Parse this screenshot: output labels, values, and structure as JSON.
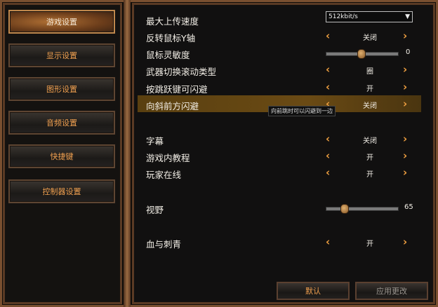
{
  "sidebar": {
    "items": [
      {
        "label": "游戏设置",
        "active": true
      },
      {
        "label": "显示设置",
        "active": false
      },
      {
        "label": "图形设置",
        "active": false
      },
      {
        "label": "音频设置",
        "active": false
      },
      {
        "label": "快捷键",
        "active": false
      },
      {
        "label": "控制器设置",
        "active": false
      }
    ]
  },
  "settings": {
    "upload_speed": {
      "label": "最大上传速度",
      "value": "512kbit/s"
    },
    "invert_mouse_y": {
      "label": "反转鼠标Y轴",
      "value": "关闭"
    },
    "mouse_sensitivity": {
      "label": "鼠标灵敏度",
      "value": "0"
    },
    "weapon_switch": {
      "label": "武器切换滚动类型",
      "value": "圈"
    },
    "jump_dodge": {
      "label": "按跳跃键可闪避",
      "value": "开"
    },
    "diagonal_dodge": {
      "label": "向斜前方闪避",
      "value": "关闭",
      "tooltip": "向前跳时可以闪避到一边"
    },
    "subtitles": {
      "label": "字幕",
      "value": "关闭"
    },
    "tutorial": {
      "label": "游戏内教程",
      "value": "开"
    },
    "player_online": {
      "label": "玩家在线",
      "value": "开"
    },
    "fov": {
      "label": "视野",
      "value": "65"
    },
    "blood_tattoo": {
      "label": "血与刺青",
      "value": "开"
    }
  },
  "footer": {
    "default_label": "默认",
    "apply_label": "应用更改"
  },
  "colors": {
    "accent": "#f0a040",
    "frame": "#7a5030"
  }
}
